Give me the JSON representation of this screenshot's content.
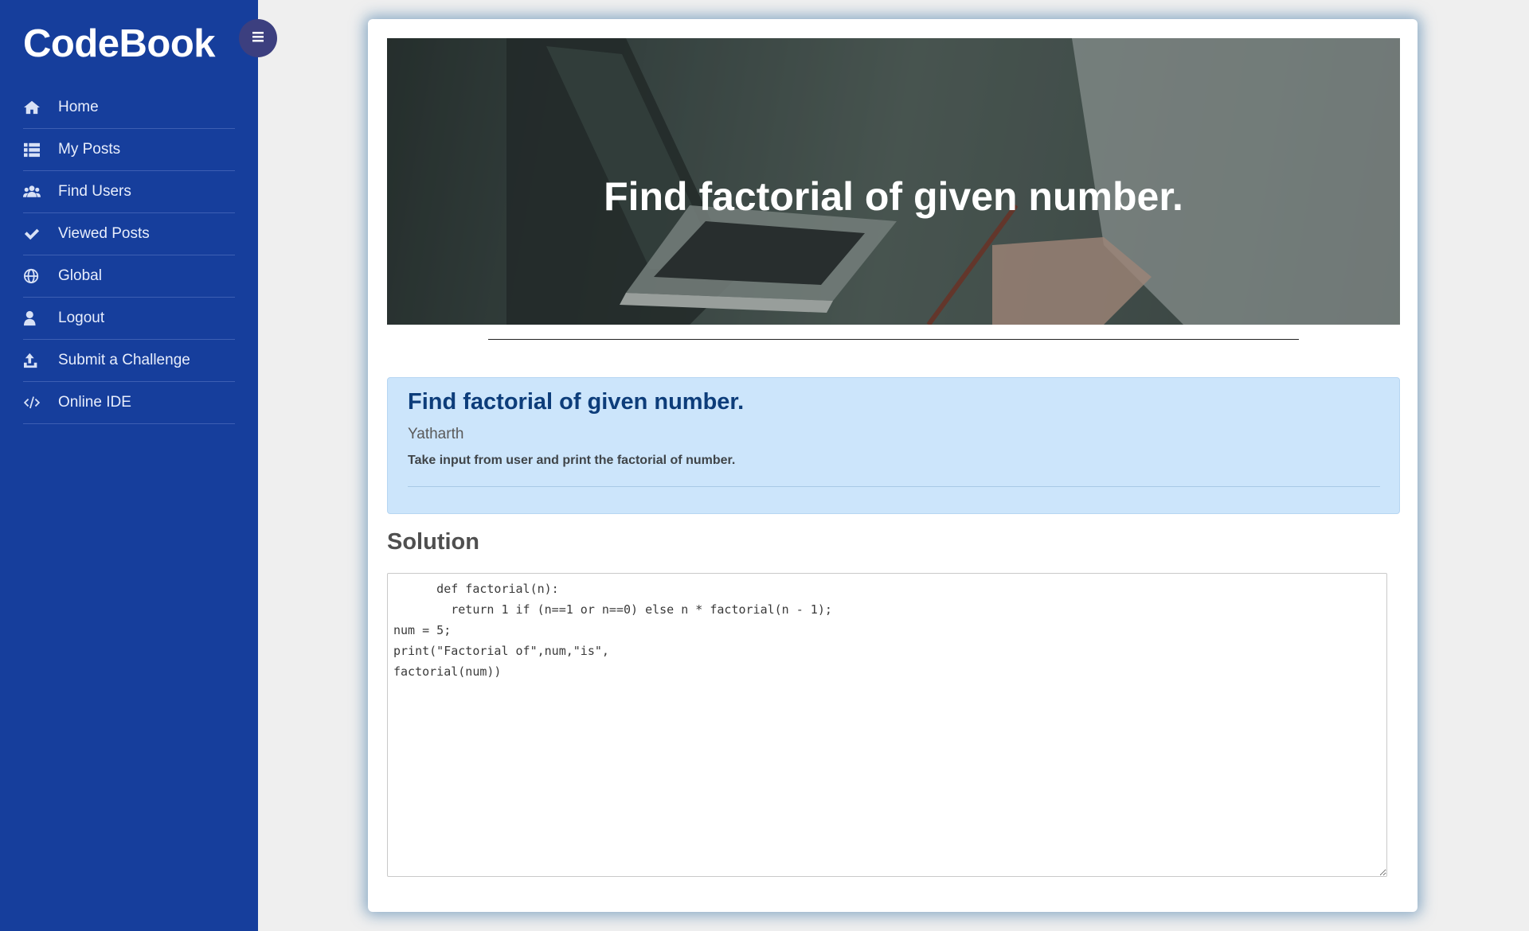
{
  "sidebar": {
    "brand": "CodeBook",
    "items": [
      {
        "label": "Home",
        "icon": "home-icon"
      },
      {
        "label": "My Posts",
        "icon": "list-icon"
      },
      {
        "label": "Find Users",
        "icon": "users-icon"
      },
      {
        "label": "Viewed Posts",
        "icon": "check-icon"
      },
      {
        "label": "Global",
        "icon": "globe-icon"
      },
      {
        "label": "Logout",
        "icon": "user-icon"
      },
      {
        "label": "Submit a Challenge",
        "icon": "upload-icon"
      },
      {
        "label": "Online IDE",
        "icon": "code-icon"
      }
    ]
  },
  "toggle": {
    "icon": "hamburger-icon"
  },
  "post": {
    "hero_title": "Find factorial of given number.",
    "title": "Find factorial of given number.",
    "author": "Yatharth",
    "description": "Take input from user and print the factorial of number."
  },
  "solution": {
    "heading": "Solution",
    "code": "      def factorial(n):\n        return 1 if (n==1 or n==0) else n * factorial(n - 1);\nnum = 5;\nprint(\"Factorial of\",num,\"is\",\nfactorial(num))"
  },
  "colors": {
    "sidebar": "#163e9c",
    "toggle": "#3c3f7f",
    "info_box": "#cce5fb",
    "info_title": "#0d3d7a"
  }
}
